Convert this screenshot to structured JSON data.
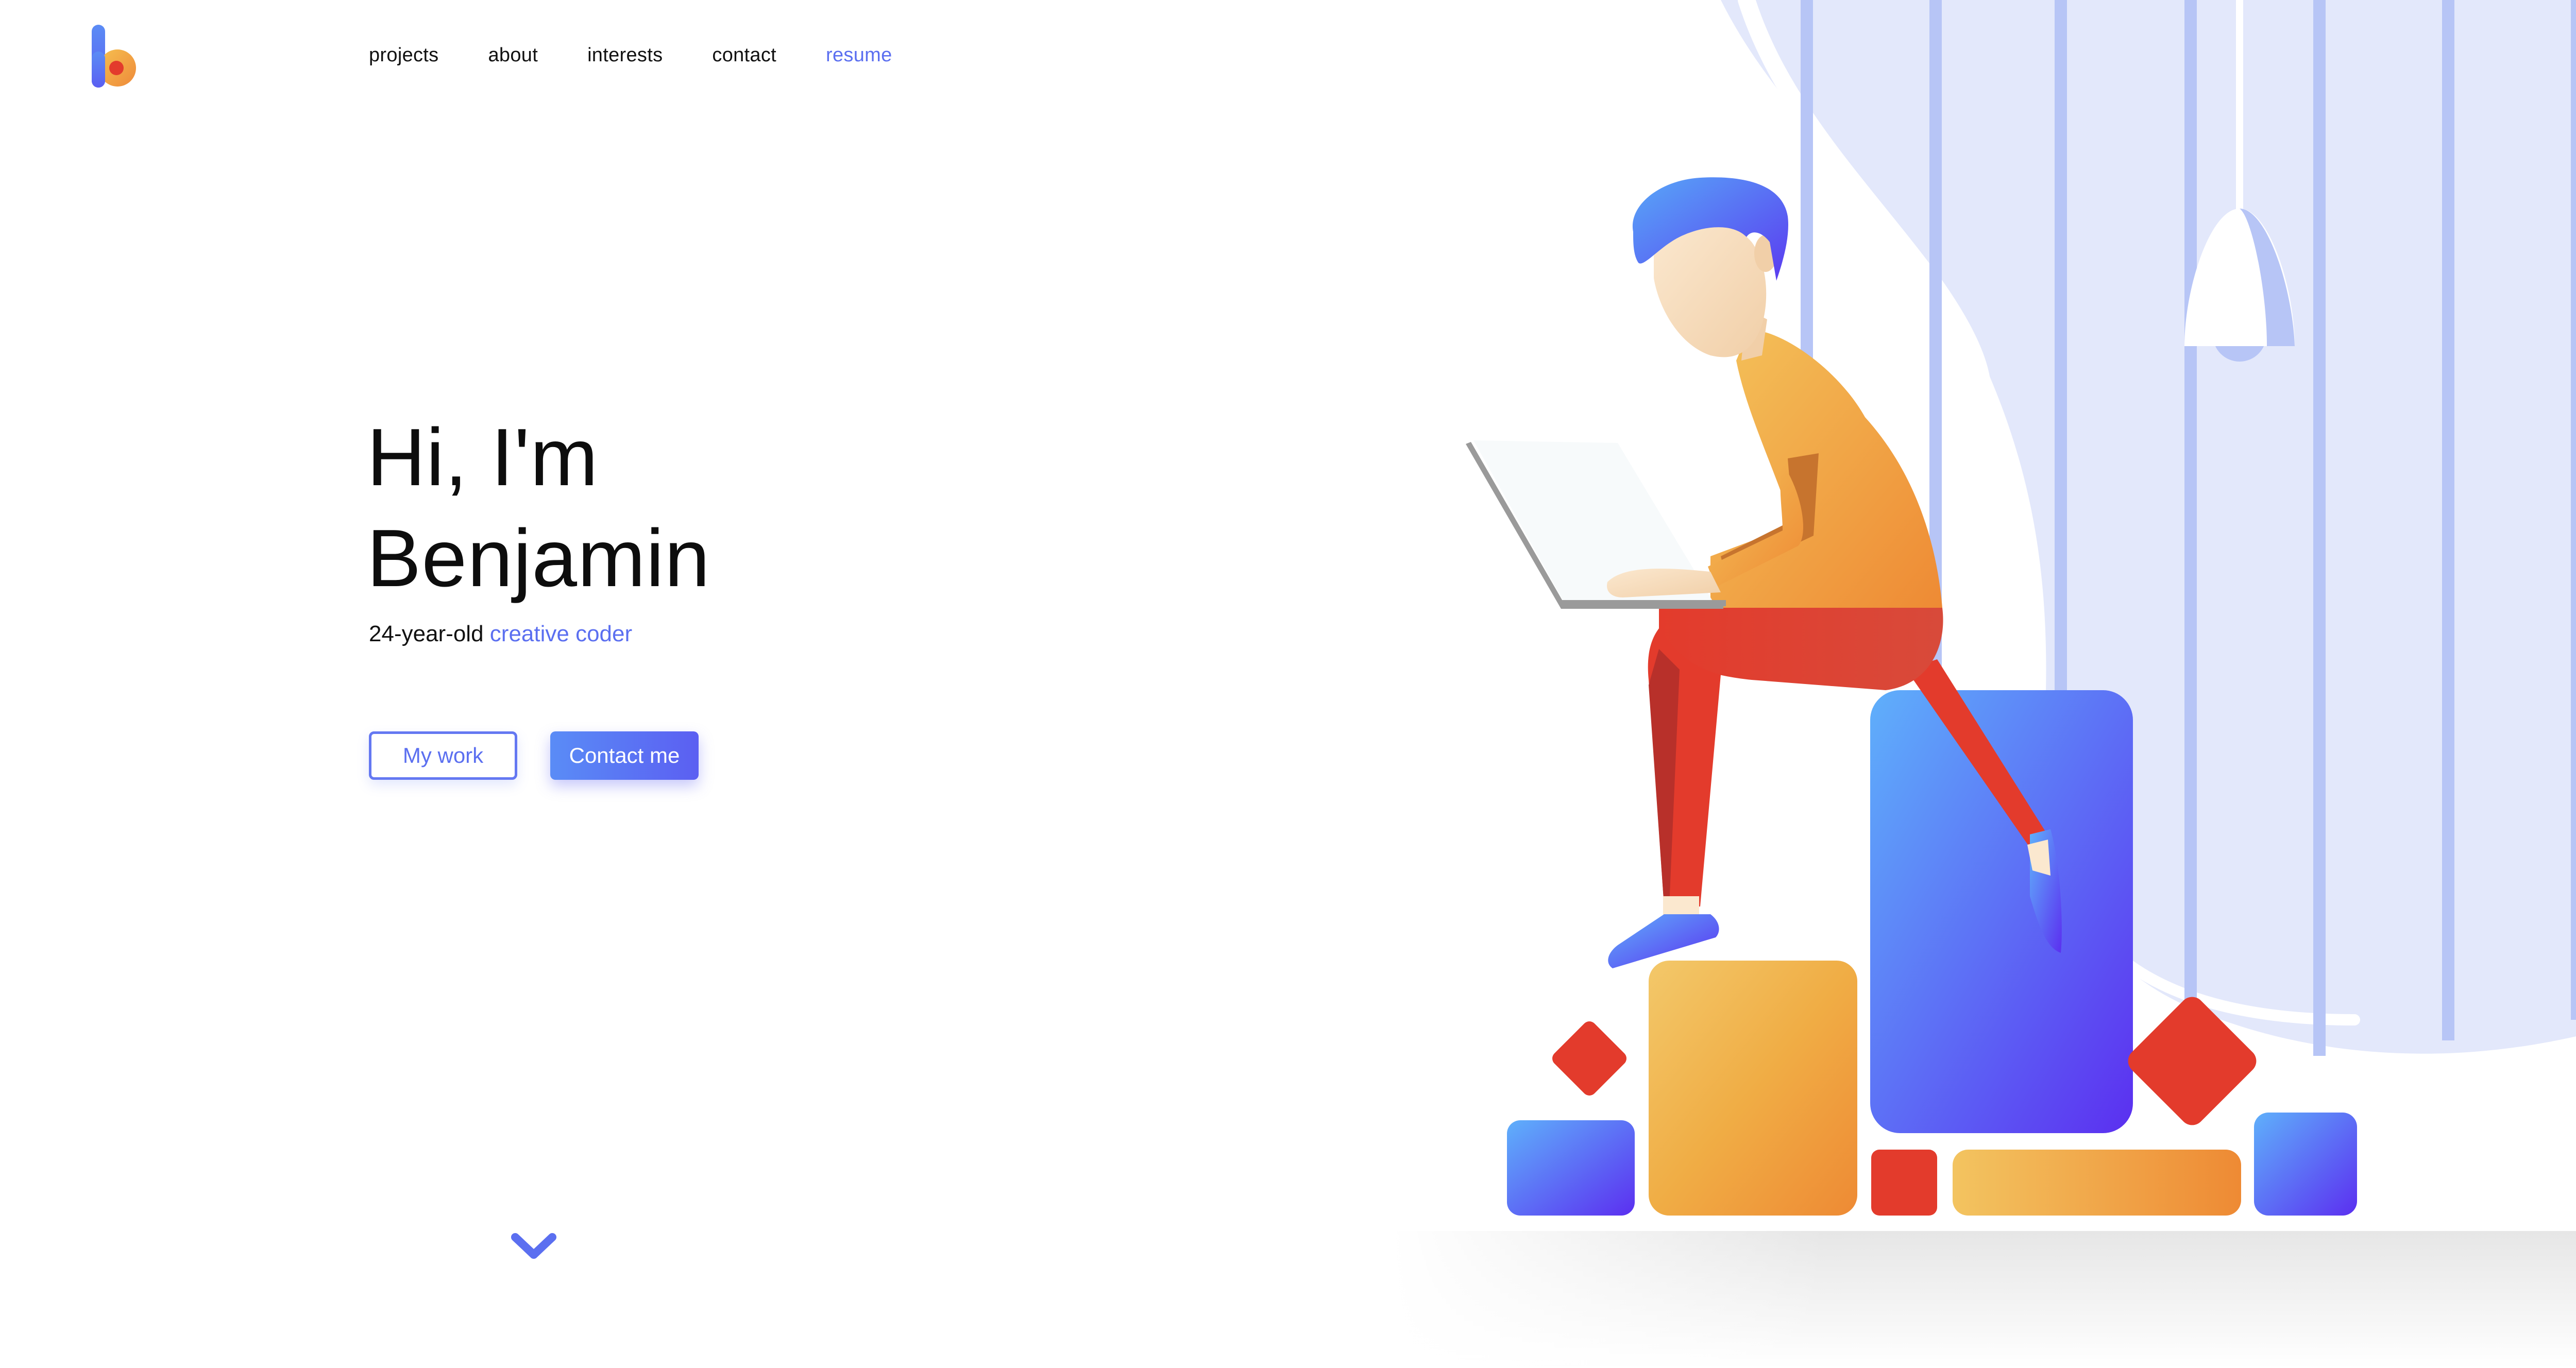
{
  "logo": {
    "icon": "b-logo-icon",
    "colors": [
      "#5b6ff0",
      "#f0a040",
      "#e33b2c"
    ]
  },
  "nav": {
    "items": [
      {
        "label": "projects"
      },
      {
        "label": "about"
      },
      {
        "label": "interests"
      },
      {
        "label": "contact"
      },
      {
        "label": "resume"
      }
    ],
    "active_color": "#5b6ff0"
  },
  "hero": {
    "greeting_line1": "Hi, I'm",
    "greeting_line2": "Benjamin",
    "subtitle_prefix": "24-year-old",
    "subtitle_accent": "creative coder"
  },
  "buttons": {
    "work_label": "My work",
    "contact_label": "Contact me"
  },
  "scroll": {
    "icon": "chevron-down-icon"
  },
  "colors": {
    "accent": "#5b6ff0",
    "orange": "#f0a040",
    "red": "#e33b2c",
    "lavender_bg": "#e3e8fb",
    "stripe": "#b7c5f6"
  },
  "illustration": {
    "icon": "developer-on-laptop-illustration"
  }
}
